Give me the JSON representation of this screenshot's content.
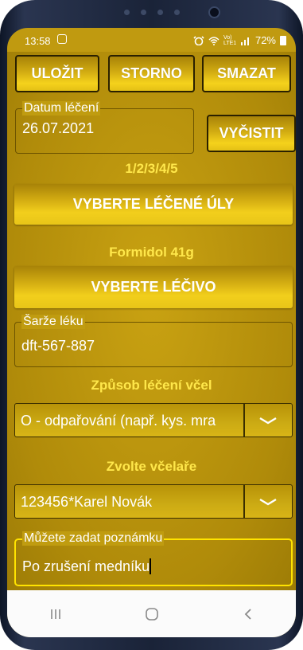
{
  "status": {
    "time": "13:58",
    "network": "Vo) LTE1",
    "battery": "72%"
  },
  "toolbar": {
    "save_label": "ULOŽIT",
    "cancel_label": "STORNO",
    "delete_label": "SMAZAT"
  },
  "date": {
    "legend": "Datum léčení",
    "value": "26.07.2021",
    "clear_label": "VYČISTIT"
  },
  "hives": {
    "selected_text": "1/2/3/4/5",
    "button_label": "VYBERTE LÉČENÉ ÚLY"
  },
  "medicine": {
    "selected_text": "Formidol 41g",
    "button_label": "VYBERTE LÉČIVO"
  },
  "batch": {
    "legend": "Šarže léku",
    "value": "dft-567-887"
  },
  "method": {
    "heading": "Způsob léčení včel",
    "selected": "O - odpařování (např. kys. mra"
  },
  "beekeeper": {
    "heading": "Zvolte včelaře",
    "selected": "123456*Karel Novák"
  },
  "note": {
    "legend": "Můžete zadat poznámku",
    "value": "Po zrušení medníku"
  },
  "colors": {
    "background": "#c09a10",
    "gold_text": "#ffe74a",
    "focus_border": "#ffe300"
  },
  "icons": [
    "notification-icon",
    "alarm-icon",
    "wifi-icon",
    "signal-icon",
    "battery-icon",
    "chevron-down-icon",
    "recent-apps-icon",
    "home-icon",
    "back-icon"
  ]
}
